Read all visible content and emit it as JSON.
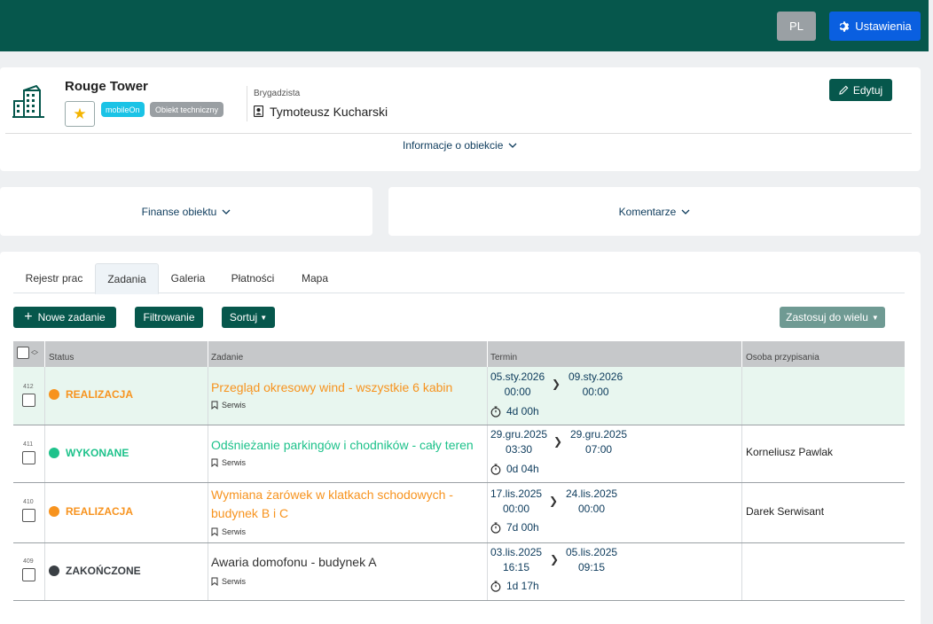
{
  "header": {
    "lang": "PL",
    "settings_label": "Ustawienia",
    "settings_icon": "gear-icon"
  },
  "object": {
    "name": "Rouge Tower",
    "badges": [
      "mobileOn",
      "Obiekt techniczny"
    ],
    "foreman_label": "Brygadzista",
    "foreman_name": "Tymoteusz Kucharski",
    "edit_label": "Edytuj",
    "info_label": "Informacje o obiekcie"
  },
  "panels": {
    "finance": "Finanse obiektu",
    "comments": "Komentarze"
  },
  "tabs": [
    "Rejestr prac",
    "Zadania",
    "Galeria",
    "Płatności",
    "Mapa"
  ],
  "active_tab": "Zadania",
  "toolbar": {
    "new_task": "Nowe zadanie",
    "filter": "Filtrowanie",
    "sort": "Sortuj",
    "bulk": "Zastosuj do wielu"
  },
  "table": {
    "columns": [
      "Status",
      "Zadanie",
      "Termin",
      "Osoba przypisania"
    ],
    "rows": [
      {
        "id": "412",
        "status": "REALIZACJA",
        "status_color": "#f7931e",
        "title": "Przegląd okresowy wind - wszystkie 6 kabin",
        "title_color": "#f7931e",
        "tag": "Serwis",
        "start_date": "05.sty.2026",
        "start_time": "00:00",
        "end_date": "09.sty.2026",
        "end_time": "00:00",
        "duration": "4d 00h",
        "person": ""
      },
      {
        "id": "411",
        "status": "WYKONANE",
        "status_color": "#1ec28b",
        "title": "Odśnieżanie parkingów i chodników - cały teren",
        "title_color": "#1ec28b",
        "tag": "Serwis",
        "start_date": "29.gru.2025",
        "start_time": "03:30",
        "end_date": "29.gru.2025",
        "end_time": "07:00",
        "duration": "0d 04h",
        "person": "Korneliusz Pawlak"
      },
      {
        "id": "410",
        "status": "REALIZACJA",
        "status_color": "#f7931e",
        "title": "Wymiana żarówek w klatkach schodowych - budynek B i C",
        "title_color": "#f7931e",
        "tag": "Serwis",
        "start_date": "17.lis.2025",
        "start_time": "00:00",
        "end_date": "24.lis.2025",
        "end_time": "00:00",
        "duration": "7d 00h",
        "person": "Darek Serwisant"
      },
      {
        "id": "409",
        "status": "ZAKOŃCZONE",
        "status_color": "#3a3f44",
        "title": "Awaria domofonu - budynek A",
        "title_color": "#333333",
        "tag": "Serwis",
        "start_date": "03.lis.2025",
        "start_time": "16:15",
        "end_date": "05.lis.2025",
        "end_time": "09:15",
        "duration": "1d 17h",
        "person": ""
      }
    ]
  }
}
